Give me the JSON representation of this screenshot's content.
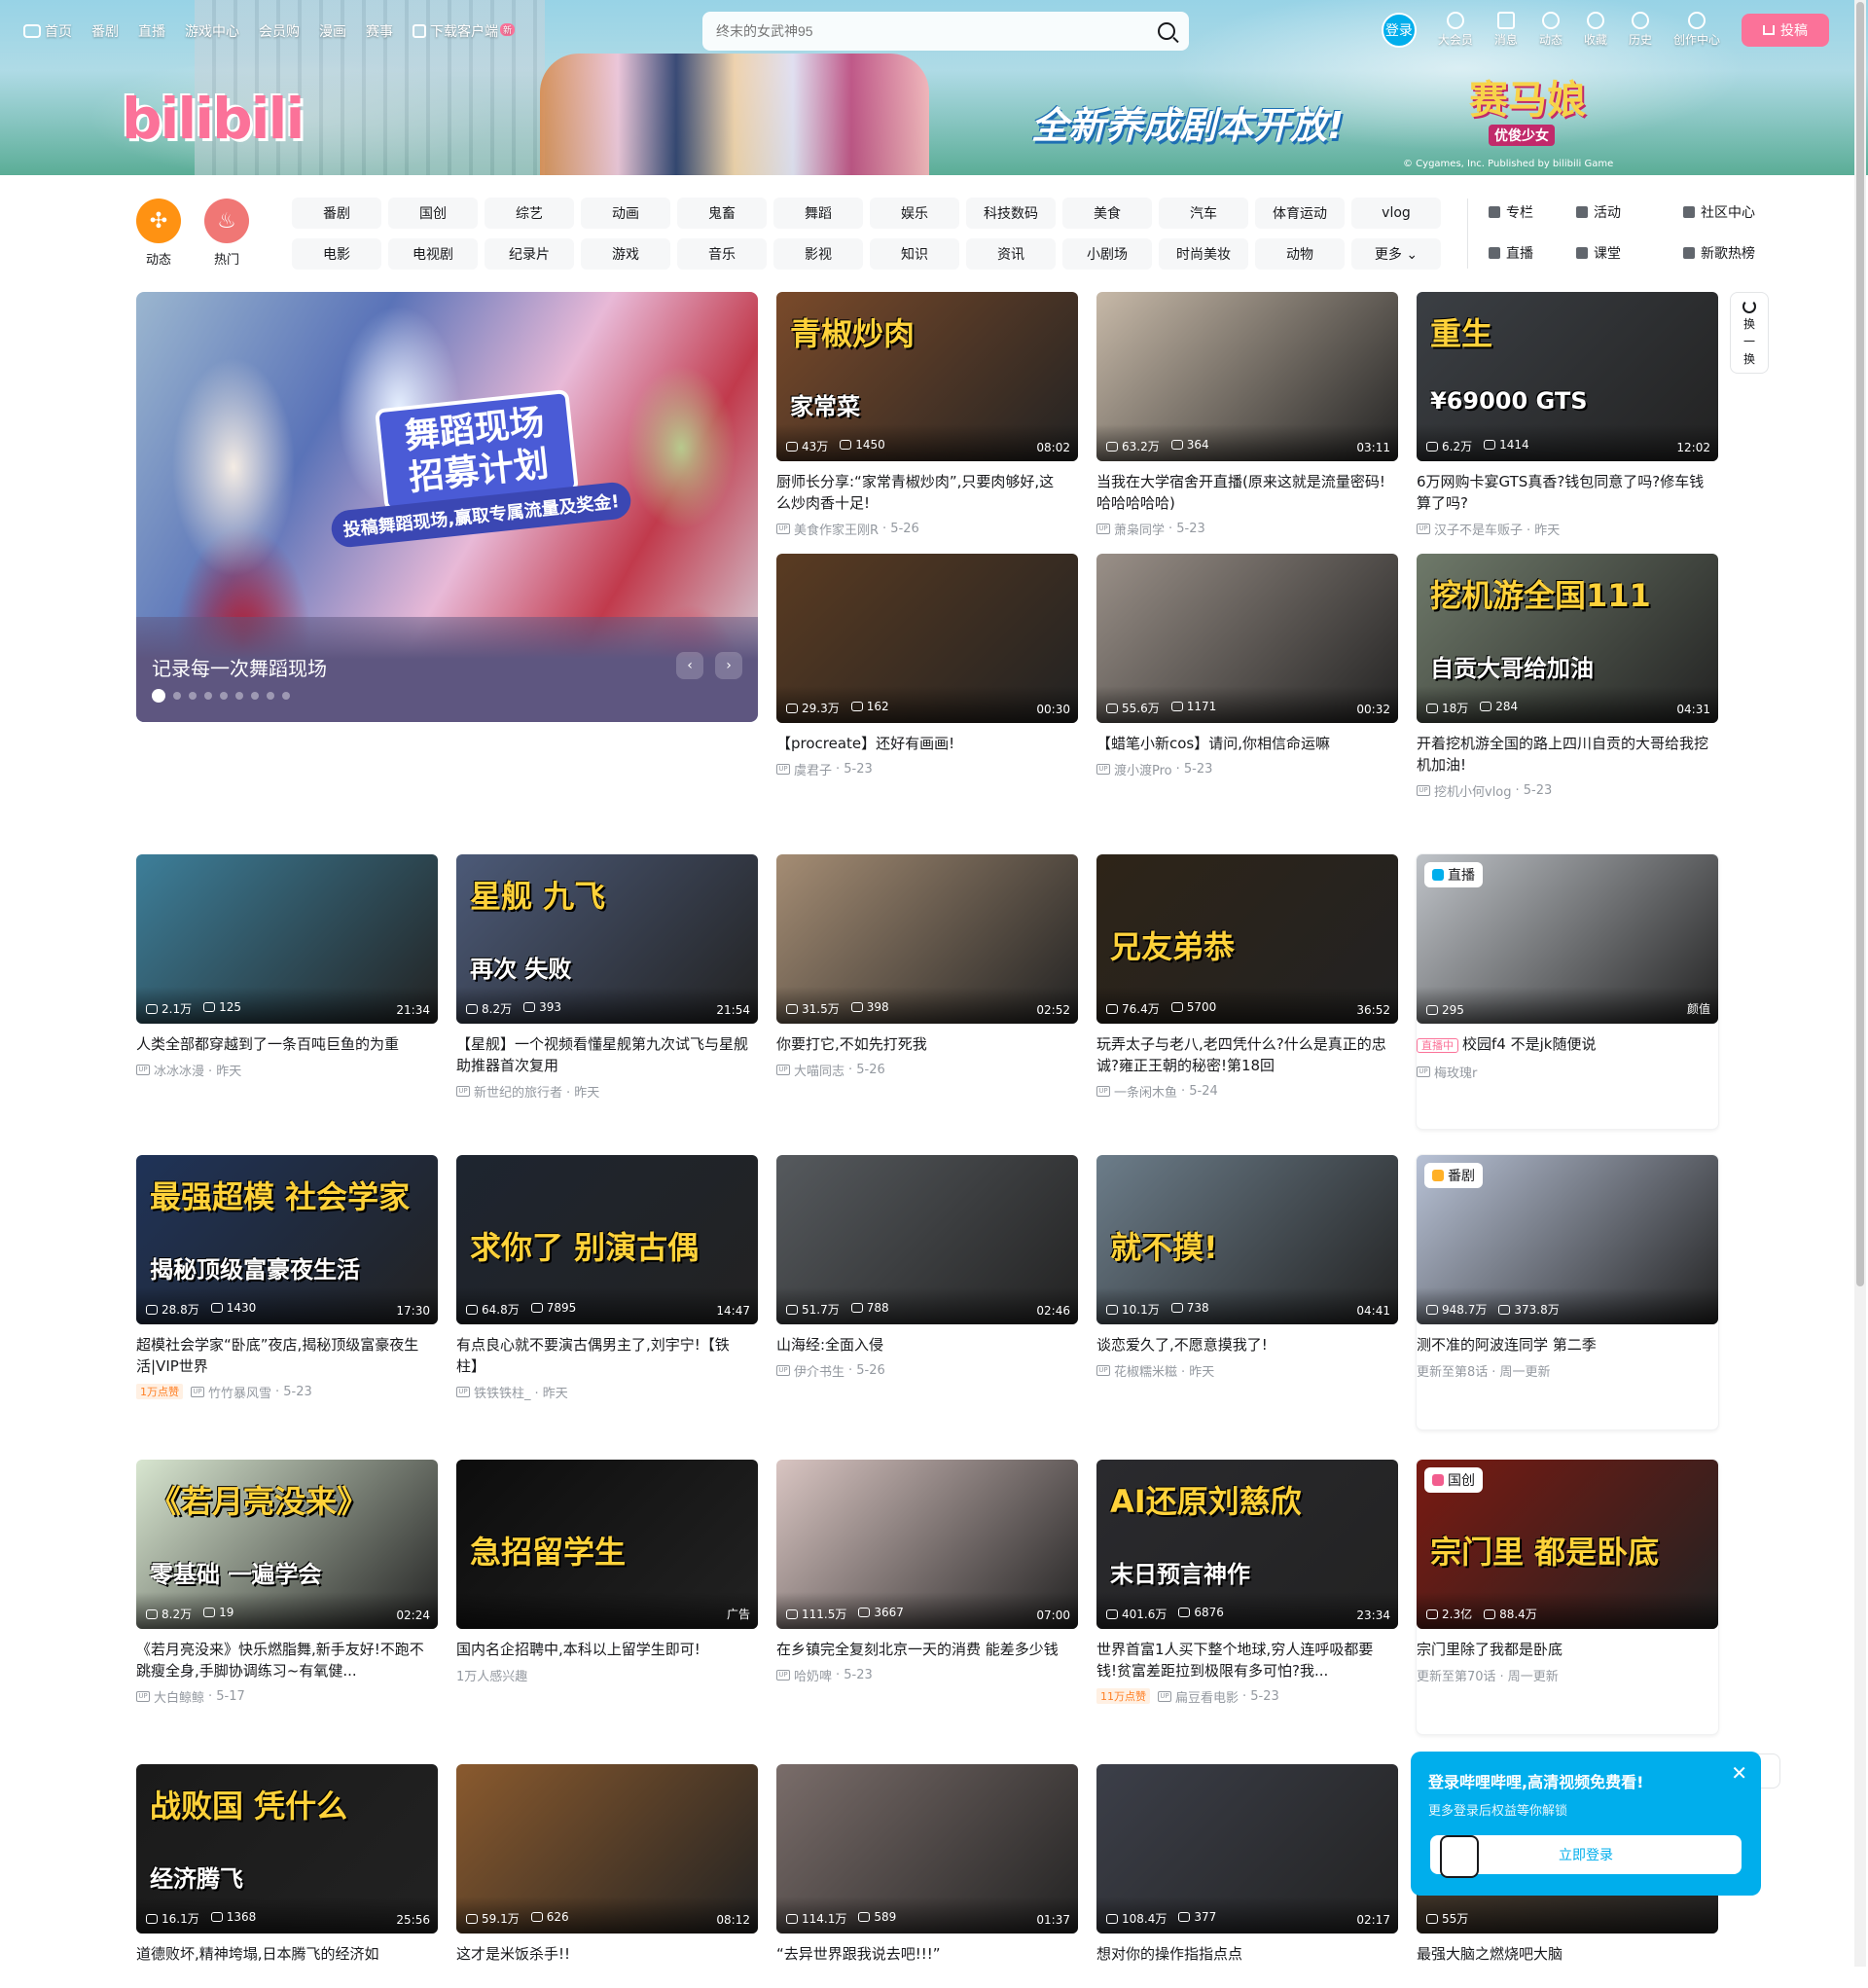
{
  "nav": {
    "left": [
      "首页",
      "番剧",
      "直播",
      "游戏中心",
      "会员购",
      "漫画",
      "赛事"
    ],
    "download": "下载客户端",
    "new_badge": "新",
    "search_placeholder": "终末的女武神95",
    "login": "登录",
    "right": [
      "大会员",
      "消息",
      "动态",
      "收藏",
      "历史",
      "创作中心"
    ],
    "upload": "投稿"
  },
  "banner": {
    "logo": "bilibili",
    "slogan": "全新养成剧本开放!",
    "game_title": "赛马娘",
    "game_sub": "优俊少女",
    "copyright": "© Cygames, Inc. Published by bilibili Game"
  },
  "channels": {
    "dynamic": "动态",
    "hot": "热门",
    "chips": [
      "番剧",
      "国创",
      "综艺",
      "动画",
      "鬼畜",
      "舞蹈",
      "娱乐",
      "科技数码",
      "美食",
      "汽车",
      "体育运动",
      "vlog",
      "电影",
      "电视剧",
      "纪录片",
      "游戏",
      "音乐",
      "影视",
      "知识",
      "资讯",
      "小剧场",
      "时尚美妆",
      "动物",
      "更多"
    ],
    "links": [
      "专栏",
      "活动",
      "社区中心",
      "直播",
      "课堂",
      "新歌热榜"
    ]
  },
  "carousel": {
    "title": "记录每一次舞蹈现场",
    "poster_title": "舞蹈现场 招募计划",
    "poster_sub": "投稿舞蹈现场,赢取专属流量及奖金!",
    "slides": 9
  },
  "refresh": [
    "换",
    "一",
    "换"
  ],
  "cards": [
    {
      "views": "43万",
      "danmaku": "1450",
      "dur": "08:02",
      "title": "厨师长分享:“家常青椒炒肉”,只要肉够好,这么炒肉香十足!",
      "author": "美食作家王刚R",
      "date": "5-26",
      "overlay": "青椒炒肉",
      "overlay2": "家常菜",
      "bg": "#7a4a2a"
    },
    {
      "views": "63.2万",
      "danmaku": "364",
      "dur": "03:11",
      "title": "当我在大学宿舍开直播(原来这就是流量密码!哈哈哈哈哈)",
      "author": "萧枭同学",
      "date": "5-23",
      "bg": "#c7b9a8"
    },
    {
      "views": "6.2万",
      "danmaku": "1414",
      "dur": "12:02",
      "title": "6万网购卡宴GTS真香?钱包同意了吗?修车钱算了吗?",
      "author": "汉子不是车贩子",
      "date": "昨天",
      "overlay": "重生",
      "overlay2": "¥69000 GTS",
      "bg": "#3b3f44"
    },
    {
      "views": "29.3万",
      "danmaku": "162",
      "dur": "00:30",
      "title": "【procreate】还好有画画!",
      "author": "虞君子",
      "date": "5-23",
      "bg": "#5a3b22"
    },
    {
      "views": "55.6万",
      "danmaku": "1171",
      "dur": "00:32",
      "title": "【蜡笔小新cos】请问,你相信命运嘛",
      "author": "渡小渡Pro",
      "date": "5-23",
      "bg": "#9a9088"
    },
    {
      "views": "18万",
      "danmaku": "284",
      "dur": "04:31",
      "title": "开着挖机游全国的路上四川自贡的大哥给我挖机加油!",
      "author": "挖机小何vlog",
      "date": "5-23",
      "overlay": "挖机游全国111",
      "overlay2": "自贡大哥给加油",
      "bg": "#6f7a6a"
    },
    {
      "views": "2.1万",
      "danmaku": "125",
      "dur": "21:34",
      "title": "人类全部都穿越到了一条百吨巨鱼的为重",
      "author": "冰冰冰漫",
      "date": "昨天",
      "bg": "#3d7f9a"
    },
    {
      "views": "8.2万",
      "danmaku": "393",
      "dur": "21:54",
      "title": "【星舰】一个视频看懂星舰第九次试飞与星舰助推器首次复用",
      "author": "新世纪的旅行者",
      "date": "昨天",
      "overlay": "星舰 九飞",
      "overlay2": "再次 失败",
      "bg": "#4c5a78"
    },
    {
      "views": "31.5万",
      "danmaku": "398",
      "dur": "02:52",
      "title": "你要打它,不如先打死我",
      "author": "大喵同志",
      "date": "5-26",
      "bg": "#a58d74"
    },
    {
      "views": "76.4万",
      "danmaku": "5700",
      "dur": "36:52",
      "title": "玩弄太子与老八,老四凭什么?什么是真正的忠诚?雍正王朝的秘密!第18回",
      "author": "一条闲木鱼",
      "date": "5-24",
      "overlay": "兄友弟恭",
      "bg": "#2e2418"
    },
    {
      "tag": "直播",
      "views": "295",
      "dur": "颜值",
      "title": "校园f4 不是jk随便说",
      "live": "直播中",
      "author": "梅玫瑰r",
      "date": "",
      "bg": "#bfc3c8"
    },
    {
      "views": "28.8万",
      "danmaku": "1430",
      "dur": "17:30",
      "title": "超模社会学家“卧底”夜店,揭秘顶级富豪夜生活|VIP世界",
      "hot": "1万点赞",
      "author": "竹竹暴风雪",
      "date": "5-23",
      "overlay": "最强超模 社会学家",
      "overlay2": "揭秘顶级富豪夜生活",
      "bg": "#1f3358"
    },
    {
      "views": "64.8万",
      "danmaku": "7895",
      "dur": "14:47",
      "title": "有点良心就不要演古偶男主了,刘宇宁!【铁柱】",
      "author": "铁铁铁柱_",
      "date": "昨天",
      "overlay": "求你了 别演古偶",
      "bg": "#1e2530"
    },
    {
      "views": "51.7万",
      "danmaku": "788",
      "dur": "02:46",
      "title": "山海经:全面入侵",
      "author": "伊介书生",
      "date": "5-26",
      "bg": "#565a5e"
    },
    {
      "views": "10.1万",
      "danmaku": "738",
      "dur": "04:41",
      "title": "谈恋爱久了,不愿意摸我了!",
      "author": "花椒糯米糍",
      "date": "昨天",
      "overlay": "就不摸!",
      "bg": "#6c7d8a"
    },
    {
      "tag": "番剧",
      "views": "948.7万",
      "danmaku": "373.8万",
      "dur": "",
      "title": "测不准的阿波连同学 第二季",
      "author": "更新至第8话",
      "date": "周一更新",
      "bg": "#b8c2d6"
    },
    {
      "views": "8.2万",
      "danmaku": "19",
      "dur": "02:24",
      "title": "《若月亮没来》快乐燃脂舞,新手友好!不跑不跳瘦全身,手脚协调练习~有氧健...",
      "author": "大白鲸鲸",
      "date": "5-17",
      "overlay": "《若月亮没来》",
      "overlay2": "零基础 一遍学会",
      "bg": "#d8e6d0"
    },
    {
      "views": "",
      "danmaku": "",
      "dur": "广告",
      "title": "国内名企招聘中,本科以上留学生即可!",
      "author": "1万人感兴趣",
      "date": "",
      "overlay": "急招留学生",
      "bg": "#0d0d0d"
    },
    {
      "views": "111.5万",
      "danmaku": "3667",
      "dur": "07:00",
      "title": "在乡镇完全复刻北京一天的消费 能差多少钱",
      "author": "哈奶啤",
      "date": "5-23",
      "bg": "#d9c5c2"
    },
    {
      "views": "401.6万",
      "danmaku": "6876",
      "dur": "23:34",
      "title": "世界首富1人买下整个地球,穷人连呼吸都要钱!贫富差距拉到极限有多可怕?我...",
      "hot": "11万点赞",
      "author": "扁豆看电影",
      "date": "5-23",
      "overlay": "AI还原刘慈欣",
      "overlay2": "末日预言神作",
      "bg": "#2a2a2e"
    },
    {
      "tag": "国创",
      "views": "2.3亿",
      "danmaku": "88.4万",
      "dur": "",
      "title": "宗门里除了我都是卧底",
      "author": "更新至第70话",
      "date": "周一更新",
      "overlay": "宗门里 都是卧底",
      "bg": "#7a1a12"
    },
    {
      "views": "16.1万",
      "danmaku": "1368",
      "dur": "25:56",
      "title": "道德败坏,精神垮塌,日本腾飞的经济如",
      "overlay": "战败国 凭什么",
      "overlay2": "经济腾飞",
      "bg": "#1a1a1a"
    },
    {
      "views": "59.1万",
      "danmaku": "626",
      "dur": "08:12",
      "title": "这才是米饭杀手!!",
      "bg": "#8a5a2e"
    },
    {
      "views": "114.1万",
      "danmaku": "589",
      "dur": "01:37",
      "title": "“去异世界跟我说去吧!!!”",
      "bg": "#7a6d6a"
    },
    {
      "views": "108.4万",
      "danmaku": "377",
      "dur": "02:17",
      "title": "想对你的操作指指点点",
      "bg": "#3c3f49"
    },
    {
      "views": "55万",
      "danmaku": "",
      "dur": "",
      "title": "最强大脑之燃烧吧大脑",
      "bg": "#4a3a2a"
    }
  ],
  "popup": {
    "title": "登录哔哩哔哩,高清视频免费看!",
    "sub": "更多登录后权益等你解锁",
    "button": "立即登录"
  },
  "colors": {
    "pink": "#fb7299",
    "blue": "#00aeec",
    "orange": "#ff7f24"
  }
}
